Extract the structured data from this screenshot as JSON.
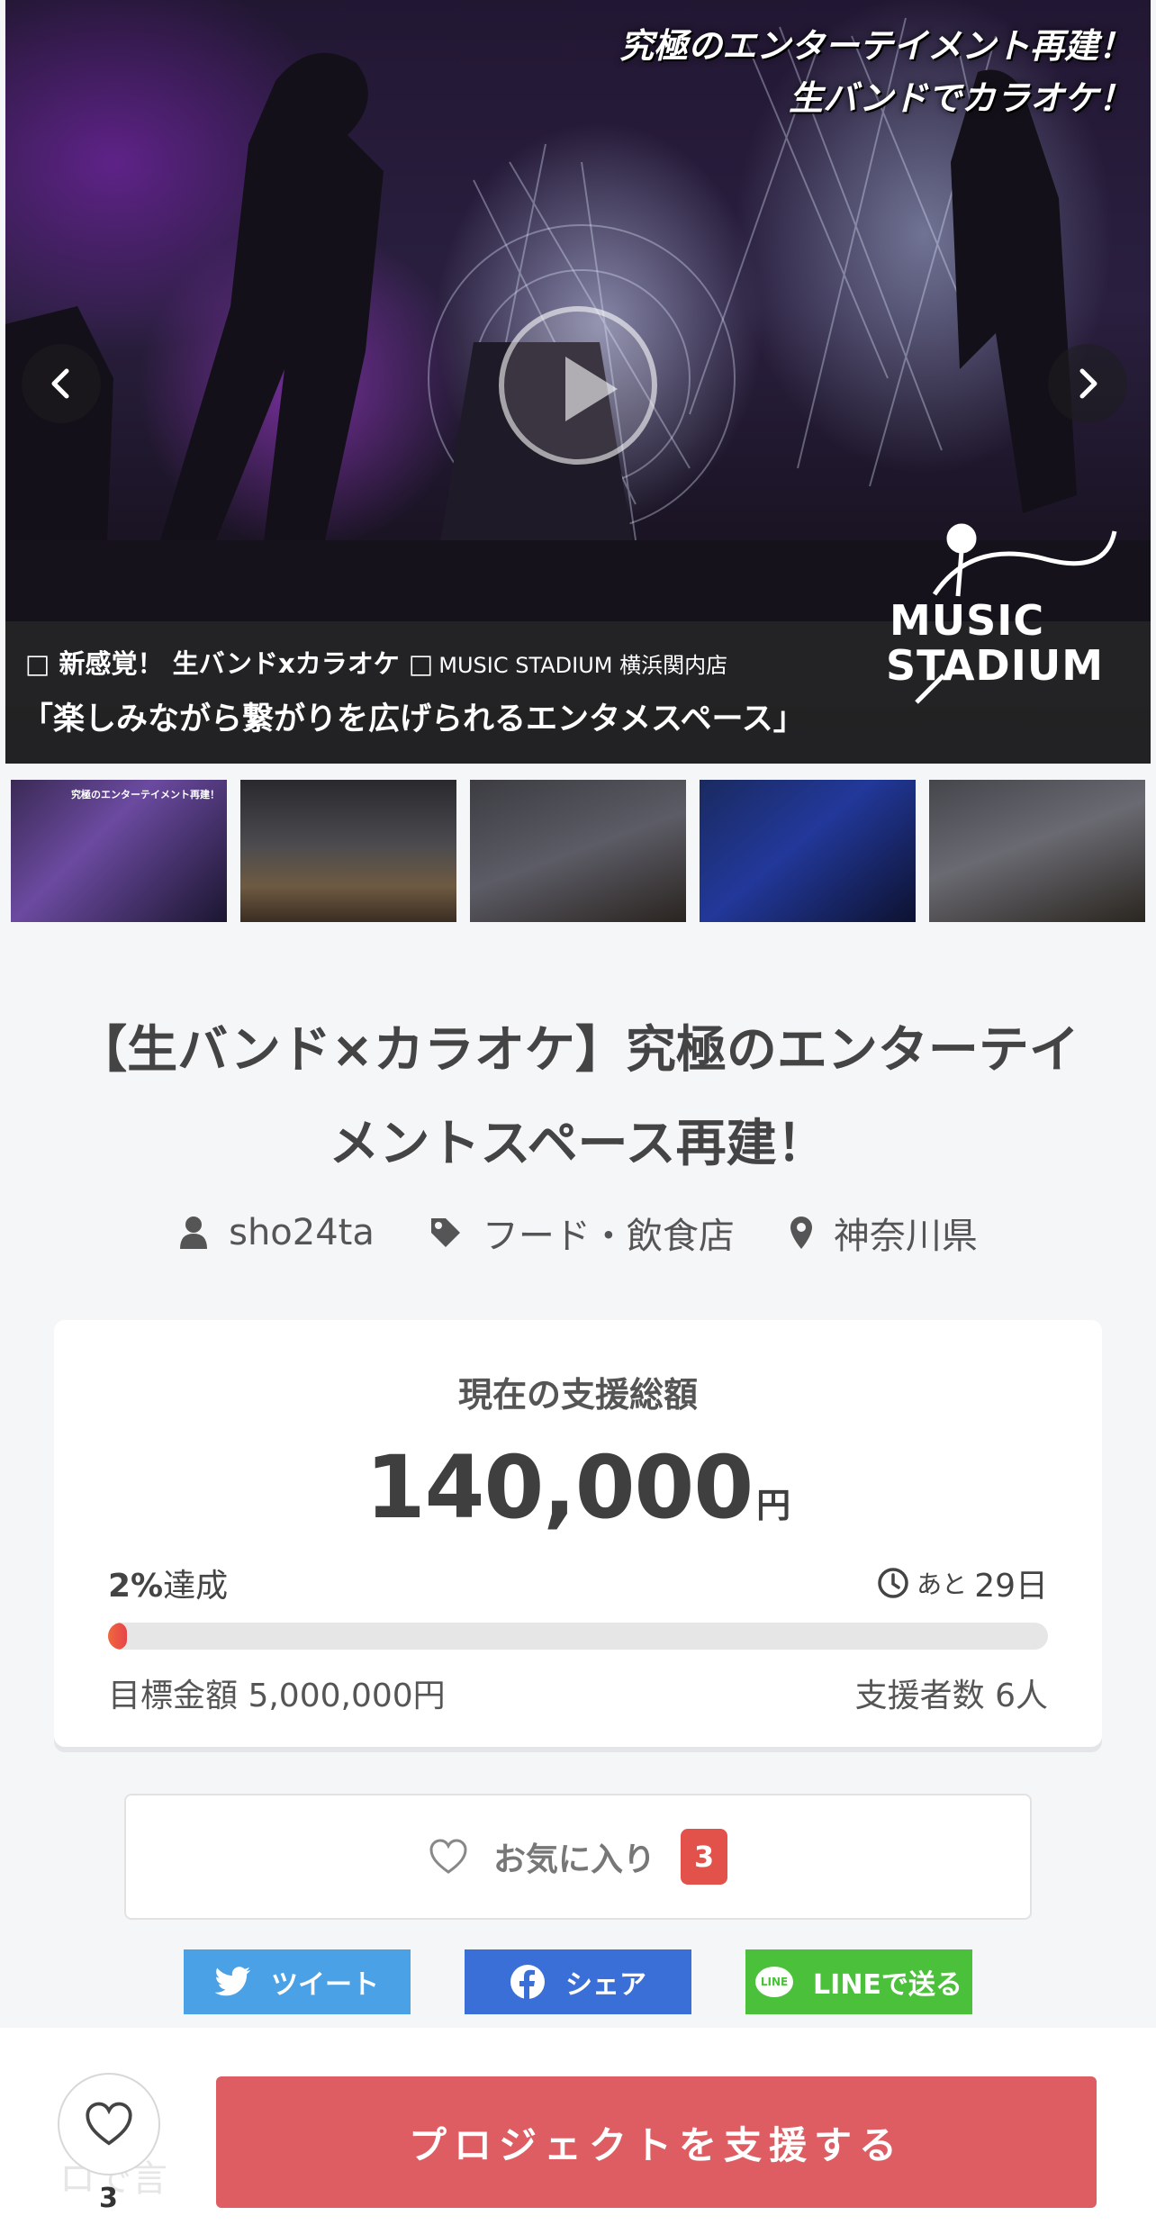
{
  "hero": {
    "caption_line1": "究極のエンターテイメント再建！",
    "caption_line2": "生バンドでカラオケ！",
    "banner_line1": "□ 新感覚！ 生バンドxカラオケ □",
    "banner_line1_sub": "MUSIC STADIUM 横浜関内店",
    "banner_line2": "「楽しみながら繋がりを広げられるエンタメスペース」",
    "logo_line1": "MUSIC",
    "logo_line2": "STADIUM",
    "prev_icon": "chevron-left-icon",
    "next_icon": "chevron-right-icon",
    "play_icon": "play-icon"
  },
  "thumbnails": [
    {
      "caption": "究極のエンターテイメント再建！"
    },
    {
      "caption": ""
    },
    {
      "caption": ""
    },
    {
      "caption": ""
    },
    {
      "caption": ""
    }
  ],
  "project": {
    "title": "【生バンド×カラオケ】究極のエンターテイメントスペース再建！",
    "owner": "sho24ta",
    "category": "フード・飲食店",
    "location": "神奈川県"
  },
  "funding": {
    "label": "現在の支援総額",
    "amount": "140,000",
    "unit": "円",
    "percent_value": "2%",
    "percent_suffix": "達成",
    "progress_fraction": 0.02,
    "remaining_prefix": "あと",
    "remaining_days": "29日",
    "goal_text": "目標金額 5,000,000円",
    "backers_text": "支援者数 6人"
  },
  "favorite": {
    "label": "お気に入り",
    "count": "3"
  },
  "share": {
    "twitter": "ツイート",
    "facebook": "シェア",
    "line": "LINEで送る",
    "line_badge": "LINE"
  },
  "bottom_bar": {
    "ghost_text": "8/... \nロで言",
    "heart_count": "3",
    "support_button": "プロジェクトを支援する"
  },
  "colors": {
    "accent_red": "#dd5d63",
    "badge_red": "#e3524a",
    "twitter": "#4ba1e6",
    "facebook": "#3a6fd8",
    "line": "#4bc03a"
  }
}
